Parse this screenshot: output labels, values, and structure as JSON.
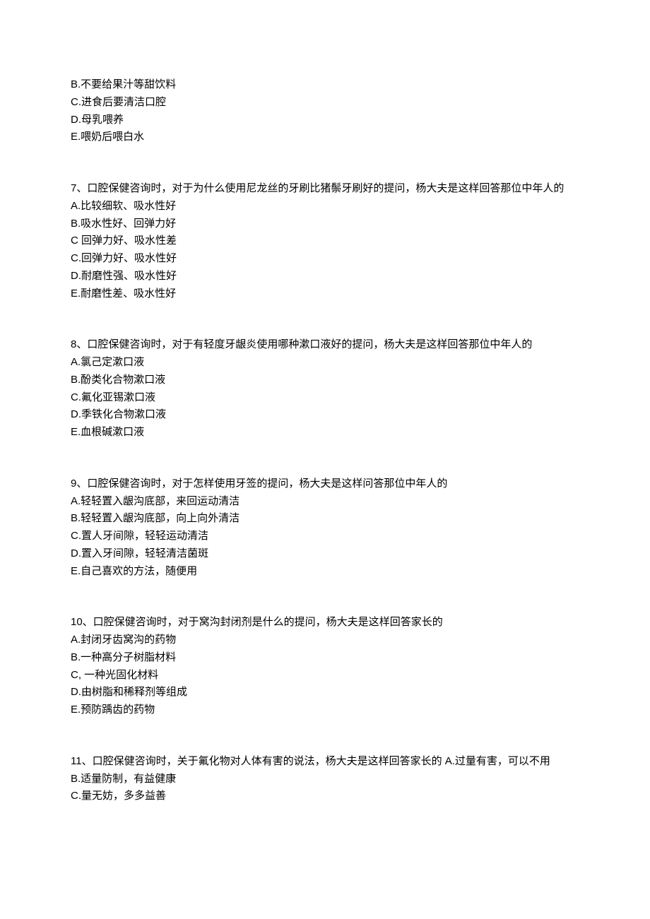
{
  "q6_partial": {
    "options": [
      "B.不要给果汁等甜饮料",
      "C.进食后要清洁口腔",
      "D.母乳喂养",
      "E.喂奶后喂白水"
    ]
  },
  "q7": {
    "stem": "7、口腔保健咨询时，对于为什么使用尼龙丝的牙刷比猪鬃牙刷好的提问，杨大夫是这样回答那位中年人的",
    "options": [
      "A.比较细软、吸水性好",
      "B.吸水性好、回弹力好",
      "C 回弹力好、吸水性差",
      "C.回弹力好、吸水性好",
      "D.耐磨性强、吸水性好",
      "E.耐磨性差、吸水性好"
    ]
  },
  "q8": {
    "stem": "8、口腔保健咨询时，对于有轻度牙龈炎使用哪种漱口液好的提问，杨大夫是这样回答那位中年人的",
    "options": [
      "A.氯己定漱口液",
      "B.酚类化合物漱口液",
      "C.氟化亚锡漱口液",
      "D.季铁化合物漱口液",
      "E.血根碱漱口液"
    ]
  },
  "q9": {
    "stem": "9、口腔保健咨询时，对于怎样使用牙签的提问，杨大夫是这样问答那位中年人的",
    "options": [
      "A.轻轻置入龈沟底部，来回运动清洁",
      "B.轻轻置入龈沟底部，向上向外清洁",
      "C.置人牙间隙，轻轻运动清洁",
      "D.置入牙间隙，轻轻清洁菌斑",
      "E.自己喜欢的方法，随便用"
    ]
  },
  "q10": {
    "stem": "10、口腔保健咨询时，对于窝沟封闭剂是什么的提问，杨大夫是这样回答家长的",
    "options": [
      "A.封闭牙齿窝沟的药物",
      "B.一种高分子树脂材料",
      "C, 一种光固化材料",
      "D.由树脂和稀释剂等组成",
      "E.预防踽齿的药物"
    ]
  },
  "q11": {
    "stem": "11、口腔保健咨询时，关于氟化物对人体有害的说法，杨大夫是这样回答家长的 A.过量有害，可以不用",
    "options": [
      "B.适量防制，有益健康",
      "C.量无妨，多多益善"
    ]
  }
}
